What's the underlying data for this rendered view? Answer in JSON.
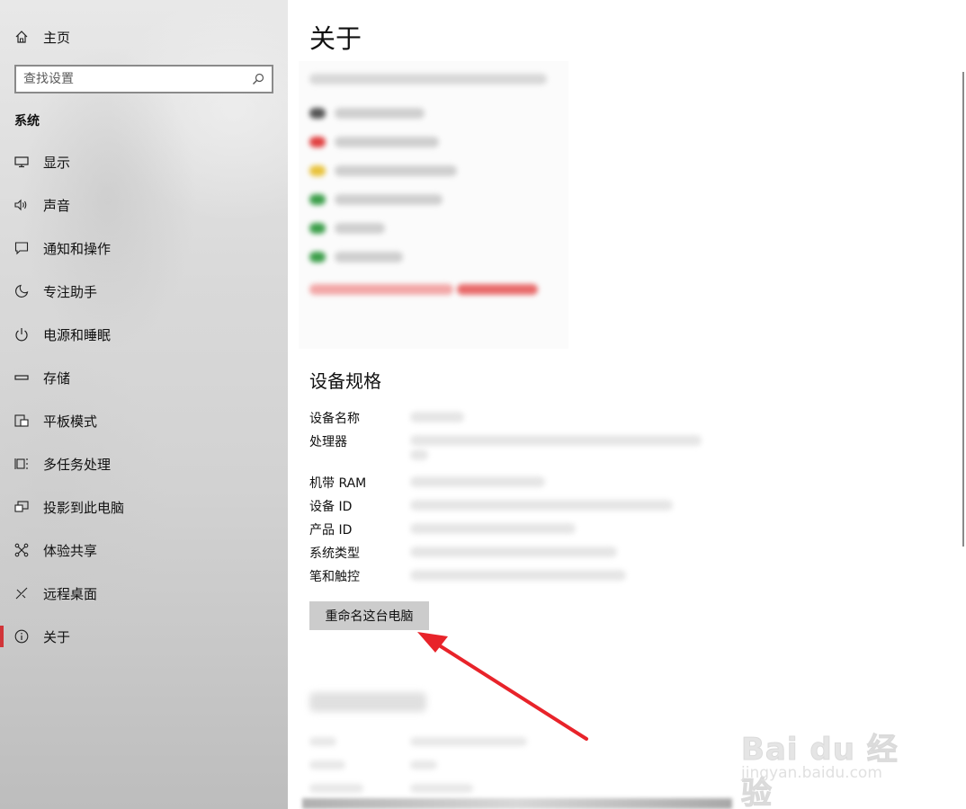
{
  "sidebar": {
    "home_label": "主页",
    "search_placeholder": "查找设置",
    "section_title": "系统",
    "items": [
      {
        "label": "显示",
        "icon": "display-icon"
      },
      {
        "label": "声音",
        "icon": "speaker-icon"
      },
      {
        "label": "通知和操作",
        "icon": "notification-icon"
      },
      {
        "label": "专注助手",
        "icon": "moon-icon"
      },
      {
        "label": "电源和睡眠",
        "icon": "power-icon"
      },
      {
        "label": "存储",
        "icon": "storage-icon"
      },
      {
        "label": "平板模式",
        "icon": "tablet-icon"
      },
      {
        "label": "多任务处理",
        "icon": "multitask-icon"
      },
      {
        "label": "投影到此电脑",
        "icon": "project-icon"
      },
      {
        "label": "体验共享",
        "icon": "share-icon"
      },
      {
        "label": "远程桌面",
        "icon": "remote-icon"
      },
      {
        "label": "关于",
        "icon": "info-icon",
        "active": true
      }
    ]
  },
  "main": {
    "title": "关于",
    "specs_title": "设备规格",
    "specs": [
      {
        "label": "设备名称"
      },
      {
        "label": "处理器"
      },
      {
        "label": "机带 RAM"
      },
      {
        "label": "设备 ID"
      },
      {
        "label": "产品 ID"
      },
      {
        "label": "系统类型"
      },
      {
        "label": "笔和触控"
      }
    ],
    "rename_button": "重命名这台电脑"
  },
  "watermark": {
    "main": "Bai du 经验",
    "sub": "jingyan.baidu.com"
  },
  "colors": {
    "accent": "#d13438",
    "arrow": "#e8232a",
    "button_bg": "#cccccc"
  }
}
